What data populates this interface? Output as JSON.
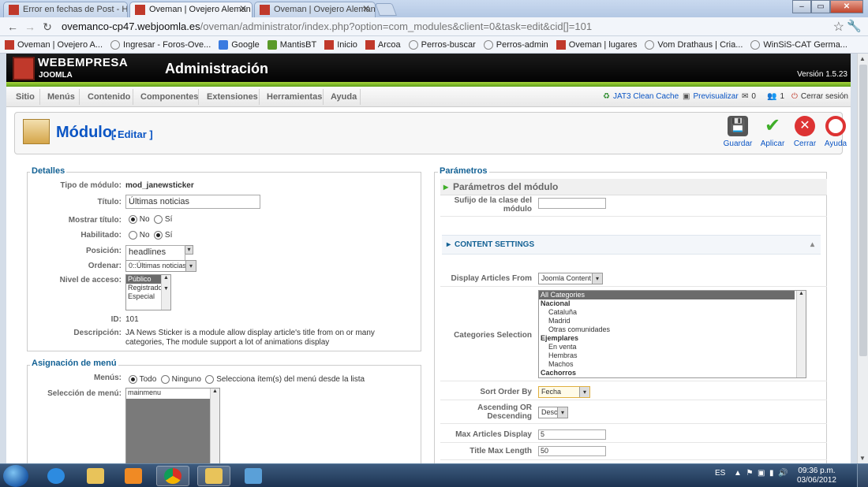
{
  "browser": {
    "tabs": [
      {
        "label": "Error en fechas de Post - He",
        "active": false
      },
      {
        "label": "Oveman | Ovejero Aleman",
        "active": true
      },
      {
        "label": "Oveman | Ovejero Aleman",
        "active": false
      }
    ],
    "url_host": "ovemanco-cp47.webjoomla.es",
    "url_path": "/oveman/administrator/index.php?option=com_modules&client=0&task=edit&cid[]=101",
    "bookmarks": [
      "Oveman | Ovejero A...",
      "Ingresar - Foros-Ove...",
      "Google",
      "MantisBT",
      "Inicio",
      "Arcoa",
      "Perros-buscar",
      "Perros-admin",
      "Oveman | lugares",
      "Vom Drathaus | Cria...",
      "WinSiS-CAT Germa..."
    ]
  },
  "header": {
    "brand": "WEBEMPRESA",
    "brand_sub": "JOOMLA",
    "title": "Administración",
    "version": "Versión 1.5.23"
  },
  "menu": {
    "items": [
      "Sitio",
      "Menús",
      "Contenido",
      "Componentes",
      "Extensiones",
      "Herramientas",
      "Ayuda"
    ],
    "clean_cache": "JAT3 Clean Cache",
    "preview": "Previsualizar",
    "messages": "0",
    "users": "1",
    "logout": "Cerrar sesión"
  },
  "toolbar": {
    "title": "Módulo:",
    "subtitle": "[ Editar ]",
    "save": "Guardar",
    "apply": "Aplicar",
    "close": "Cerrar",
    "help": "Ayuda"
  },
  "details": {
    "legend": "Detalles",
    "type_label": "Tipo de módulo:",
    "type_value": "mod_janewsticker",
    "title_label": "Título:",
    "title_value": "Últimas noticias",
    "show_title_label": "Mostrar título:",
    "no": "No",
    "yes": "Sí",
    "enabled_label": "Habilitado:",
    "position_label": "Posición:",
    "position_value": "headlines",
    "order_label": "Ordenar:",
    "order_value": "0::Últimas noticias",
    "access_label": "Nivel de acceso:",
    "access_options": [
      "Público",
      "Registrado",
      "Especial"
    ],
    "id_label": "ID:",
    "id_value": "101",
    "desc_label": "Descripción:",
    "desc_value": "JA News Sticker is a module allow display article's title from on or many categories, The module support a lot of animations display"
  },
  "menu_assign": {
    "legend": "Asignación de menú",
    "menus_label": "Menús:",
    "opt_all": "Todo",
    "opt_none": "Ninguno",
    "opt_select": "Selecciona ítem(s) del menú desde la lista",
    "selection_label": "Selección de menú:",
    "selection_first": "mainmenu"
  },
  "params": {
    "legend": "Parámetros",
    "module_params": "Parámetros del módulo",
    "suffix_label": "Sufijo de la clase del módulo",
    "content_settings": "CONTENT SETTINGS",
    "display_from_label": "Display Articles From",
    "display_from_value": "Joomla Content",
    "categories_label": "Categories Selection",
    "categories": [
      {
        "text": "All Categories",
        "bold": false,
        "sel": true,
        "indent": false
      },
      {
        "text": "Nacional",
        "bold": true,
        "sel": false,
        "indent": false
      },
      {
        "text": "Cataluña",
        "bold": false,
        "sel": false,
        "indent": true
      },
      {
        "text": "Madrid",
        "bold": false,
        "sel": false,
        "indent": true
      },
      {
        "text": "Otras comunidades",
        "bold": false,
        "sel": false,
        "indent": true
      },
      {
        "text": "Ejemplares",
        "bold": true,
        "sel": false,
        "indent": false
      },
      {
        "text": "En venta",
        "bold": false,
        "sel": false,
        "indent": true
      },
      {
        "text": "Hembras",
        "bold": false,
        "sel": false,
        "indent": true
      },
      {
        "text": "Machos",
        "bold": false,
        "sel": false,
        "indent": true
      },
      {
        "text": "Cachorros",
        "bold": true,
        "sel": false,
        "indent": false
      }
    ],
    "sort_label": "Sort Order By",
    "sort_value": "Fecha",
    "asc_label": "Ascending OR Descending",
    "asc_value": "Desc",
    "max_label": "Max Articles Display",
    "max_value": "5",
    "title_max_label": "Title Max Length",
    "title_max_value": "50"
  },
  "taskbar": {
    "lang": "ES",
    "time": "09:36 p.m.",
    "date": "03/06/2012"
  }
}
